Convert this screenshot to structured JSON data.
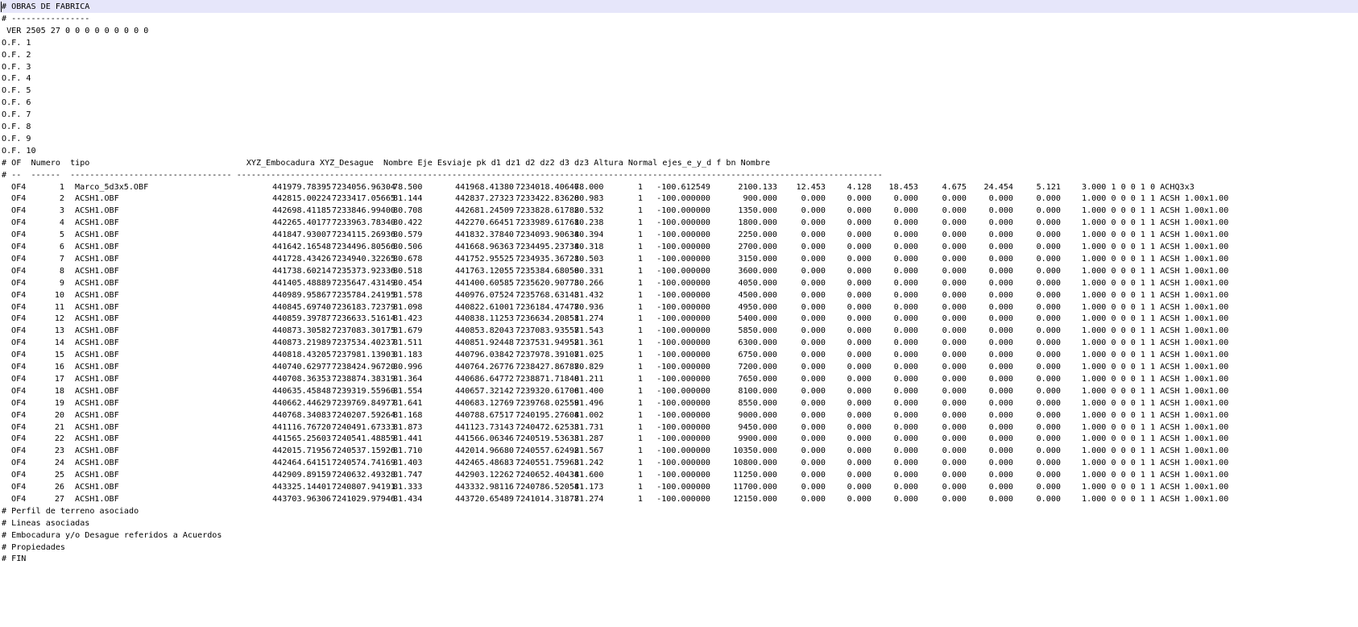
{
  "header_lines": [
    "# OBRAS DE FABRICA",
    "# ----------------",
    " VER 2505 27 0 0 0 0 0 0 0 0 0",
    "O.F. 1",
    "O.F. 2",
    "O.F. 3",
    "O.F. 4",
    "O.F. 5",
    "O.F. 6",
    "O.F. 7",
    "O.F. 8",
    "O.F. 9",
    "O.F. 10",
    "# OF  Numero  tipo                                XYZ_Embocadura XYZ_Desague  Nombre Eje Esviaje pk d1 dz1 d2 dz2 d3 dz3 Altura Normal ejes_e_y_d f bn Nombre",
    "# --  ------  --------------------------------- ------------------------------------------------------------------------------------------------------------------------------------"
  ],
  "rows": [
    [
      "OF4",
      "1",
      "Marco_5d3x5.OBF",
      "441979.78395",
      "7234056.96304",
      "78.500",
      "441968.41380",
      "7234018.40646",
      "78.000",
      "1",
      "-100.612549",
      "2100.133",
      "12.453",
      "4.128",
      "18.453",
      "4.675",
      "24.454",
      "5.121",
      "3.000 1 0 0 1 0 ACHQ3x3"
    ],
    [
      "OF4",
      "2",
      "ACSH1.OBF",
      "442815.00224",
      "7233417.05665",
      "81.144",
      "442837.27323",
      "7233422.83620",
      "80.983",
      "1",
      "-100.000000",
      "900.000",
      "0.000",
      "0.000",
      "0.000",
      "0.000",
      "0.000",
      "0.000",
      "1.000 0 0 0 1 1 ACSH 1.00x1.00"
    ],
    [
      "OF4",
      "3",
      "ACSH1.OBF",
      "442698.41185",
      "7233846.99400",
      "80.708",
      "442681.24509",
      "7233828.61782",
      "80.532",
      "1",
      "-100.000000",
      "1350.000",
      "0.000",
      "0.000",
      "0.000",
      "0.000",
      "0.000",
      "0.000",
      "1.000 0 0 0 1 1 ACSH 1.00x1.00"
    ],
    [
      "OF4",
      "4",
      "ACSH1.OBF",
      "442265.40177",
      "7233963.78340",
      "80.422",
      "442270.66451",
      "7233989.61761",
      "80.238",
      "1",
      "-100.000000",
      "1800.000",
      "0.000",
      "0.000",
      "0.000",
      "0.000",
      "0.000",
      "0.000",
      "1.000 0 0 0 1 1 ACSH 1.00x1.00"
    ],
    [
      "OF4",
      "5",
      "ACSH1.OBF",
      "441847.93007",
      "7234115.26936",
      "80.579",
      "441832.37840",
      "7234093.90634",
      "80.394",
      "1",
      "-100.000000",
      "2250.000",
      "0.000",
      "0.000",
      "0.000",
      "0.000",
      "0.000",
      "0.000",
      "1.000 0 0 0 1 1 ACSH 1.00x1.00"
    ],
    [
      "OF4",
      "6",
      "ACSH1.OBF",
      "441642.16548",
      "7234496.80566",
      "80.506",
      "441668.96363",
      "7234495.23734",
      "80.318",
      "1",
      "-100.000000",
      "2700.000",
      "0.000",
      "0.000",
      "0.000",
      "0.000",
      "0.000",
      "0.000",
      "1.000 0 0 0 1 1 ACSH 1.00x1.00"
    ],
    [
      "OF4",
      "7",
      "ACSH1.OBF",
      "441728.43426",
      "7234940.32265",
      "80.678",
      "441752.95525",
      "7234935.36721",
      "80.503",
      "1",
      "-100.000000",
      "3150.000",
      "0.000",
      "0.000",
      "0.000",
      "0.000",
      "0.000",
      "0.000",
      "1.000 0 0 0 1 1 ACSH 1.00x1.00"
    ],
    [
      "OF4",
      "8",
      "ACSH1.OBF",
      "441738.60214",
      "7235373.92336",
      "80.518",
      "441763.12055",
      "7235384.68050",
      "80.331",
      "1",
      "-100.000000",
      "3600.000",
      "0.000",
      "0.000",
      "0.000",
      "0.000",
      "0.000",
      "0.000",
      "1.000 0 0 0 1 1 ACSH 1.00x1.00"
    ],
    [
      "OF4",
      "9",
      "ACSH1.OBF",
      "441405.48889",
      "7235647.43149",
      "80.454",
      "441400.60585",
      "7235620.90773",
      "80.266",
      "1",
      "-100.000000",
      "4050.000",
      "0.000",
      "0.000",
      "0.000",
      "0.000",
      "0.000",
      "0.000",
      "1.000 0 0 0 1 1 ACSH 1.00x1.00"
    ],
    [
      "OF4",
      "10",
      "ACSH1.OBF",
      "440989.95867",
      "7235784.24195",
      "81.578",
      "440976.07524",
      "7235768.63143",
      "81.432",
      "1",
      "-100.000000",
      "4500.000",
      "0.000",
      "0.000",
      "0.000",
      "0.000",
      "0.000",
      "0.000",
      "1.000 0 0 0 1 1 ACSH 1.00x1.00"
    ],
    [
      "OF4",
      "11",
      "ACSH1.OBF",
      "440845.69740",
      "7236183.72379",
      "81.098",
      "440822.61001",
      "7236184.47477",
      "80.936",
      "1",
      "-100.000000",
      "4950.000",
      "0.000",
      "0.000",
      "0.000",
      "0.000",
      "0.000",
      "0.000",
      "1.000 0 0 0 1 1 ACSH 1.00x1.00"
    ],
    [
      "OF4",
      "12",
      "ACSH1.OBF",
      "440859.39787",
      "7236633.51614",
      "81.423",
      "440838.11253",
      "7236634.20851",
      "81.274",
      "1",
      "-100.000000",
      "5400.000",
      "0.000",
      "0.000",
      "0.000",
      "0.000",
      "0.000",
      "0.000",
      "1.000 0 0 0 1 1 ACSH 1.00x1.00"
    ],
    [
      "OF4",
      "13",
      "ACSH1.OBF",
      "440873.30582",
      "7237083.30175",
      "81.679",
      "440853.82043",
      "7237083.93557",
      "81.543",
      "1",
      "-100.000000",
      "5850.000",
      "0.000",
      "0.000",
      "0.000",
      "0.000",
      "0.000",
      "0.000",
      "1.000 0 0 0 1 1 ACSH 1.00x1.00"
    ],
    [
      "OF4",
      "14",
      "ACSH1.OBF",
      "440873.21989",
      "7237534.40237",
      "81.511",
      "440851.92448",
      "7237531.94952",
      "81.361",
      "1",
      "-100.000000",
      "6300.000",
      "0.000",
      "0.000",
      "0.000",
      "0.000",
      "0.000",
      "0.000",
      "1.000 0 0 0 1 1 ACSH 1.00x1.00"
    ],
    [
      "OF4",
      "15",
      "ACSH1.OBF",
      "440818.43205",
      "7237981.13903",
      "81.183",
      "440796.03842",
      "7237978.39107",
      "81.025",
      "1",
      "-100.000000",
      "6750.000",
      "0.000",
      "0.000",
      "0.000",
      "0.000",
      "0.000",
      "0.000",
      "1.000 0 0 0 1 1 ACSH 1.00x1.00"
    ],
    [
      "OF4",
      "16",
      "ACSH1.OBF",
      "440740.62977",
      "7238424.96720",
      "80.996",
      "440764.26776",
      "7238427.86787",
      "80.829",
      "1",
      "-100.000000",
      "7200.000",
      "0.000",
      "0.000",
      "0.000",
      "0.000",
      "0.000",
      "0.000",
      "1.000 0 0 0 1 1 ACSH 1.00x1.00"
    ],
    [
      "OF4",
      "17",
      "ACSH1.OBF",
      "440708.36353",
      "7238874.38319",
      "81.364",
      "440686.64772",
      "7238871.71840",
      "81.211",
      "1",
      "-100.000000",
      "7650.000",
      "0.000",
      "0.000",
      "0.000",
      "0.000",
      "0.000",
      "0.000",
      "1.000 0 0 0 1 1 ACSH 1.00x1.00"
    ],
    [
      "OF4",
      "18",
      "ACSH1.OBF",
      "440635.45848",
      "7239319.55960",
      "81.554",
      "440657.32142",
      "7239320.61706",
      "81.400",
      "1",
      "-100.000000",
      "8100.000",
      "0.000",
      "0.000",
      "0.000",
      "0.000",
      "0.000",
      "0.000",
      "1.000 0 0 0 1 1 ACSH 1.00x1.00"
    ],
    [
      "OF4",
      "19",
      "ACSH1.OBF",
      "440662.44629",
      "7239769.84977",
      "81.641",
      "440683.12769",
      "7239768.02559",
      "81.496",
      "1",
      "-100.000000",
      "8550.000",
      "0.000",
      "0.000",
      "0.000",
      "0.000",
      "0.000",
      "0.000",
      "1.000 0 0 0 1 1 ACSH 1.00x1.00"
    ],
    [
      "OF4",
      "20",
      "ACSH1.OBF",
      "440768.34083",
      "7240207.59264",
      "81.168",
      "440788.67517",
      "7240195.27604",
      "81.002",
      "1",
      "-100.000000",
      "9000.000",
      "0.000",
      "0.000",
      "0.000",
      "0.000",
      "0.000",
      "0.000",
      "1.000 0 0 0 1 1 ACSH 1.00x1.00"
    ],
    [
      "OF4",
      "21",
      "ACSH1.OBF",
      "441116.76720",
      "7240491.67333",
      "81.873",
      "441123.73143",
      "7240472.62533",
      "81.731",
      "1",
      "-100.000000",
      "9450.000",
      "0.000",
      "0.000",
      "0.000",
      "0.000",
      "0.000",
      "0.000",
      "1.000 0 0 0 1 1 ACSH 1.00x1.00"
    ],
    [
      "OF4",
      "22",
      "ACSH1.OBF",
      "441565.25603",
      "7240541.48859",
      "81.441",
      "441566.06346",
      "7240519.53633",
      "81.287",
      "1",
      "-100.000000",
      "9900.000",
      "0.000",
      "0.000",
      "0.000",
      "0.000",
      "0.000",
      "0.000",
      "1.000 0 0 0 1 1 ACSH 1.00x1.00"
    ],
    [
      "OF4",
      "23",
      "ACSH1.OBF",
      "442015.71956",
      "7240537.15926",
      "81.710",
      "442014.96680",
      "7240557.62492",
      "81.567",
      "1",
      "-100.000000",
      "10350.000",
      "0.000",
      "0.000",
      "0.000",
      "0.000",
      "0.000",
      "0.000",
      "1.000 0 0 0 1 1 ACSH 1.00x1.00"
    ],
    [
      "OF4",
      "24",
      "ACSH1.OBF",
      "442464.64151",
      "7240574.74169",
      "81.403",
      "442465.48683",
      "7240551.75963",
      "81.242",
      "1",
      "-100.000000",
      "10800.000",
      "0.000",
      "0.000",
      "0.000",
      "0.000",
      "0.000",
      "0.000",
      "1.000 0 0 0 1 1 ACSH 1.00x1.00"
    ],
    [
      "OF4",
      "25",
      "ACSH1.OBF",
      "442909.89159",
      "7240632.49328",
      "81.747",
      "442903.12262",
      "7240652.40434",
      "81.600",
      "1",
      "-100.000000",
      "11250.000",
      "0.000",
      "0.000",
      "0.000",
      "0.000",
      "0.000",
      "0.000",
      "1.000 0 0 0 1 1 ACSH 1.00x1.00"
    ],
    [
      "OF4",
      "26",
      "ACSH1.OBF",
      "443325.14401",
      "7240807.94191",
      "81.333",
      "443332.98116",
      "7240786.52054",
      "81.173",
      "1",
      "-100.000000",
      "11700.000",
      "0.000",
      "0.000",
      "0.000",
      "0.000",
      "0.000",
      "0.000",
      "1.000 0 0 0 1 1 ACSH 1.00x1.00"
    ],
    [
      "OF4",
      "27",
      "ACSH1.OBF",
      "443703.96306",
      "7241029.97946",
      "81.434",
      "443720.65489",
      "7241014.31877",
      "81.274",
      "1",
      "-100.000000",
      "12150.000",
      "0.000",
      "0.000",
      "0.000",
      "0.000",
      "0.000",
      "0.000",
      "1.000 0 0 0 1 1 ACSH 1.00x1.00"
    ]
  ],
  "footer_lines": [
    "# Perfil de terreno asociado",
    "# Lineas asociadas",
    "# Embocadura y/o Desague referidos a Acuerdos",
    "# Propiedades",
    "# FIN"
  ],
  "colors": {
    "background": "#ffffff",
    "text": "#000000",
    "current_line": "#e6e6fa"
  }
}
